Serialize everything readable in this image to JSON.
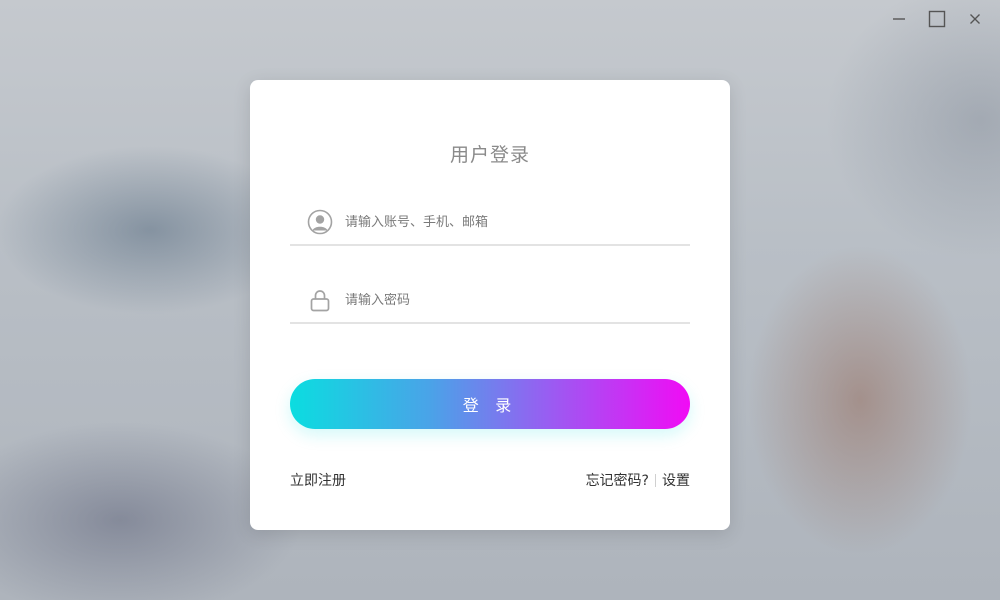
{
  "window": {
    "minimize_icon": "minimize-icon",
    "maximize_icon": "maximize-icon",
    "close_icon": "close-icon"
  },
  "login": {
    "title": "用户登录",
    "account": {
      "placeholder": "请输入账号、手机、邮箱",
      "value": "",
      "icon": "user-avatar-icon"
    },
    "password": {
      "placeholder": "请输入密码",
      "value": "",
      "icon": "lock-icon"
    },
    "submit_label": "登 录",
    "register_label": "立即注册",
    "forgot_label": "忘记密码?",
    "settings_label": "设置"
  },
  "colors": {
    "gradient_start": "#0bdde0",
    "gradient_end": "#f10bf5",
    "card_bg": "#ffffff",
    "title_color": "#8a8a8a"
  }
}
